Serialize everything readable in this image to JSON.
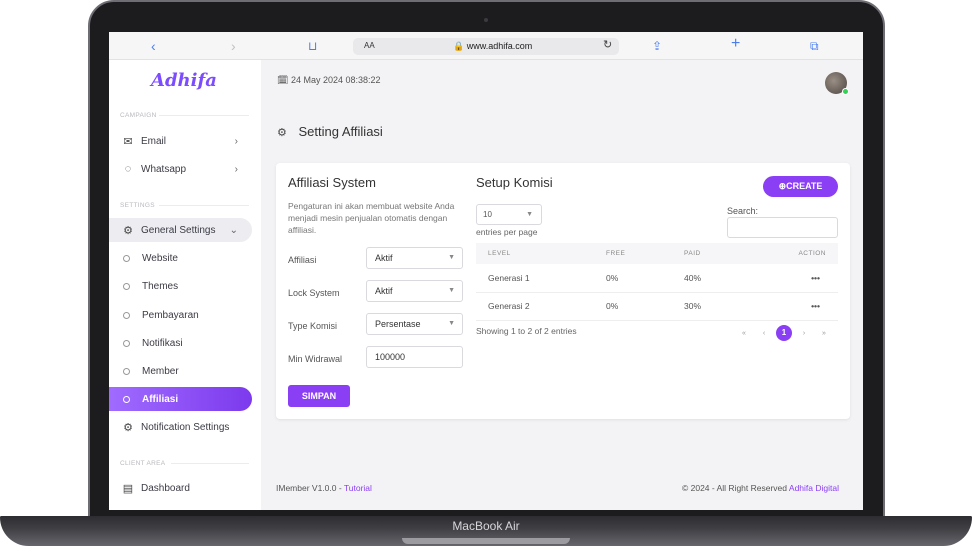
{
  "device": {
    "label": "MacBook Air"
  },
  "browser": {
    "back": "‹",
    "forward": "›",
    "book": "📖",
    "aa": "AA",
    "url": "🔒 www.adhifa.com",
    "reload": "↻",
    "share": "⇪",
    "add": "+",
    "tabs": "⧉"
  },
  "sidebar": {
    "logo": "Adhifa",
    "section_campaign": "CAMPAIGN",
    "section_settings": "SETTINGS",
    "section_client": "CLIENT AREA",
    "campaign_items": [
      {
        "label": "Email",
        "icon": "mail-icon"
      },
      {
        "label": "Whatsapp",
        "icon": "whatsapp-icon"
      }
    ],
    "general_settings": "General Settings",
    "sub_items": [
      "Website",
      "Themes",
      "Pembayaran",
      "Notifikasi",
      "Member",
      "Affiliasi"
    ],
    "notification_settings": "Notification Settings",
    "dashboard": "Dashboard"
  },
  "header": {
    "datetime": "24 May 2024 08:38:22"
  },
  "page": {
    "title": "Setting Affiliasi"
  },
  "affiliasi_system": {
    "title": "Affiliasi System",
    "description": "Pengaturan ini akan membuat website Anda menjadi mesin penjualan otomatis dengan affiliasi.",
    "fields": [
      {
        "label": "Affiliasi",
        "value": "Aktif"
      },
      {
        "label": "Lock System",
        "value": "Aktif"
      },
      {
        "label": "Type Komisi",
        "value": "Persentase"
      },
      {
        "label": "Min Widrawal",
        "value": "100000"
      }
    ],
    "save_label": "SIMPAN"
  },
  "setup_komisi": {
    "title": "Setup Komisi",
    "create_label": "⊕CREATE",
    "entries_value": "10",
    "entries_label": "entries per page",
    "search_label": "Search:",
    "columns": [
      "LEVEL",
      "FREE",
      "PAID",
      "ACTION"
    ],
    "rows": [
      {
        "level": "Generasi 1",
        "free": "0%",
        "paid": "40%",
        "action": "•••"
      },
      {
        "level": "Generasi 2",
        "free": "0%",
        "paid": "30%",
        "action": "•••"
      }
    ],
    "showing": "Showing 1 to 2 of 2 entries",
    "pager": {
      "first": "«",
      "prev": "‹",
      "current": "1",
      "next": "›",
      "last": "»"
    }
  },
  "footer": {
    "version": "IMember V1.0.0 - ",
    "tutorial": "Tutorial",
    "copyright": "© 2024 - All Right Reserved ",
    "company": "Adhifa Digital"
  },
  "colors": {
    "accent": "#8a3ff5",
    "online": "#34d058"
  }
}
